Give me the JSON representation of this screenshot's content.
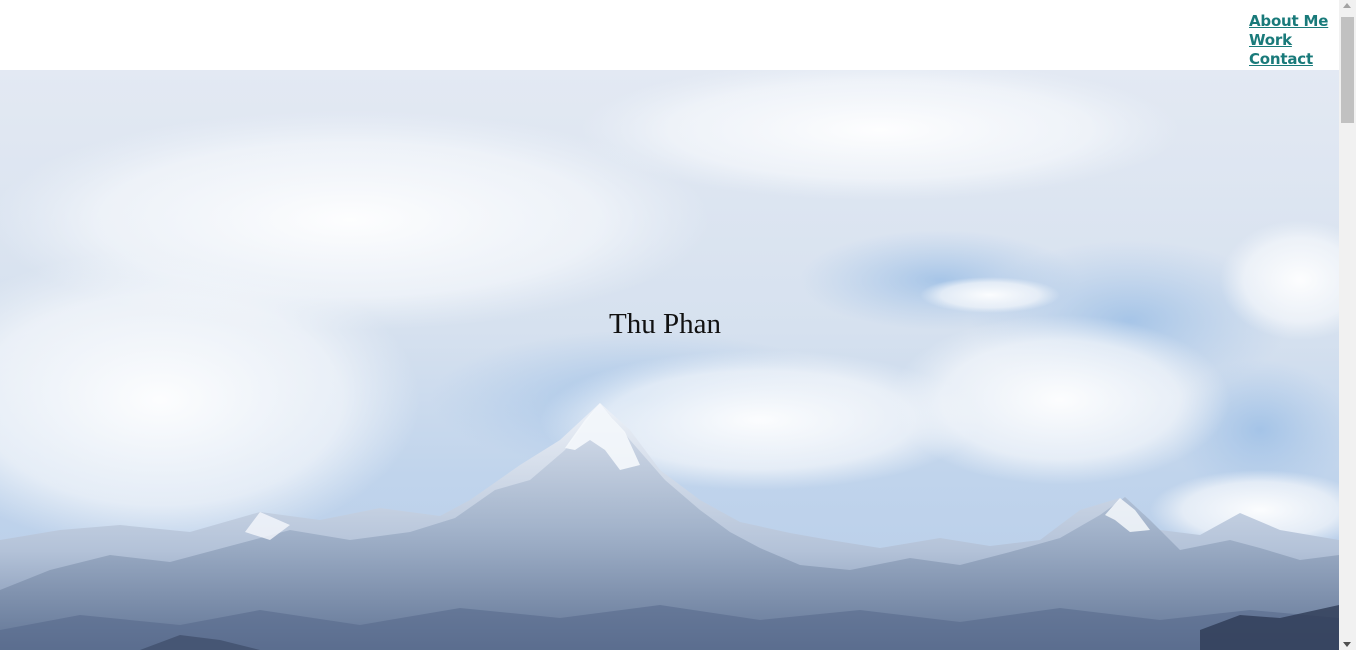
{
  "nav": {
    "items": [
      {
        "label": "About Me"
      },
      {
        "label": "Work"
      },
      {
        "label": "Contact"
      }
    ],
    "link_color": "#197a7a"
  },
  "hero": {
    "title": "Thu Phan",
    "image": "snow-capped-mountain-range-with-clouds"
  }
}
